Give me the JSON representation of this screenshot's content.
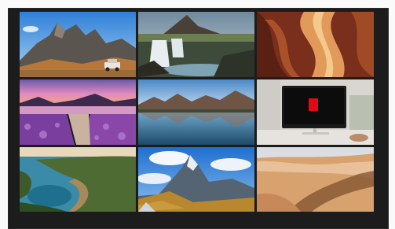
{
  "wallpapers": [
    {
      "name": "mountain-with-jeep",
      "type": "photo"
    },
    {
      "name": "waterfall-mountain",
      "type": "photo"
    },
    {
      "name": "slot-canyon",
      "type": "photo"
    },
    {
      "name": "lavender-lake-sunset",
      "type": "photo"
    },
    {
      "name": "mountain-lake-reflection",
      "type": "photo"
    },
    {
      "name": "netflix-laptop-desk",
      "type": "photo"
    },
    {
      "name": "coastal-bay-cliffs",
      "type": "photo"
    },
    {
      "name": "alpine-peaks-clouds",
      "type": "photo"
    },
    {
      "name": "desert-dunes",
      "type": "photo"
    }
  ],
  "colors": {
    "frame": "#1c1c1c",
    "page": "#fafafa",
    "netflix_red": "#e50914"
  }
}
